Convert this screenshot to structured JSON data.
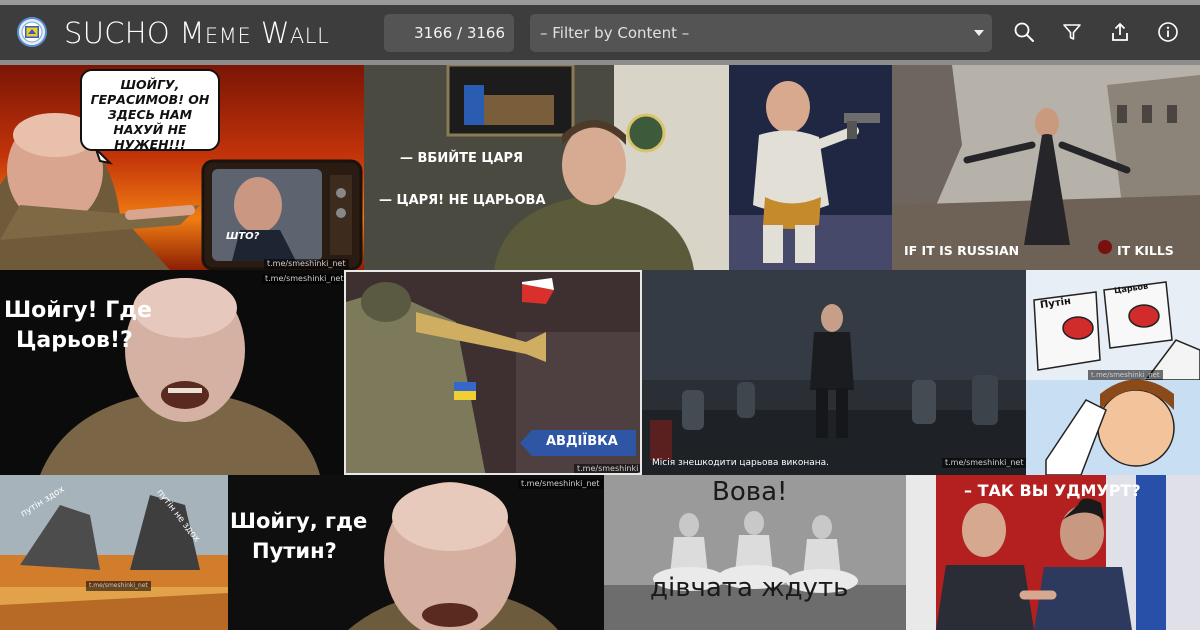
{
  "header": {
    "title_first": "SUCHO ",
    "title_m": "M",
    "title_eme": "EME",
    "title_w": " W",
    "title_all": "ALL",
    "counter": "3166 / 3166",
    "filter_label": "– Filter by Content –"
  },
  "toolbar_icons": [
    "search-icon",
    "filter-icon",
    "share-icon",
    "info-icon"
  ],
  "colors": {
    "header_bg": "#3d3d3d",
    "control_bg": "#545454",
    "accent": "#5b8fd3"
  },
  "memes": {
    "m1": {
      "bubble": "ШОЙГУ, ГЕРАСИМОВ! ОН ЗДЕСЬ НАМ НАХУЙ НЕ НУЖЕН!!!",
      "tv_caption": "ШТО?",
      "watermark": "t.me/smeshinki_net"
    },
    "m2": {
      "line1": "— ВБИЙТЕ ЦАРЯ",
      "line2": "— ЦАРЯ! НЕ ЦАРЬОВА"
    },
    "m4": {
      "left": "IF IT IS RUSSIAN",
      "right": "IT KILLS"
    },
    "m5": {
      "line1": "Шойгу! Где",
      "line2": "Царьов!?",
      "watermark": "t.me/smeshinki_net"
    },
    "m6": {
      "sign": "АВДІЇВКА",
      "watermark": "t.me/smeshinki_net"
    },
    "m7": {
      "caption": "Місія знешкодити царьова виконана.",
      "watermark": "t.me/smeshinki_net"
    },
    "m8": {
      "left_btn": "Путін",
      "right_btn": "Царьов",
      "watermark": "t.me/smeshinki_net"
    },
    "m9": {
      "left": "путін здох",
      "right": "путін не здох",
      "watermark": "t.me/smeshinki_net"
    },
    "m10": {
      "line1": "Шойгу, где",
      "line2": "Путин?",
      "watermark": "t.me/smeshinki_net"
    },
    "m11": {
      "top": "Вова!",
      "bottom": "дівчата ждуть"
    },
    "m12": {
      "caption": "– ТАК ВЫ УДМУРТ?"
    }
  }
}
